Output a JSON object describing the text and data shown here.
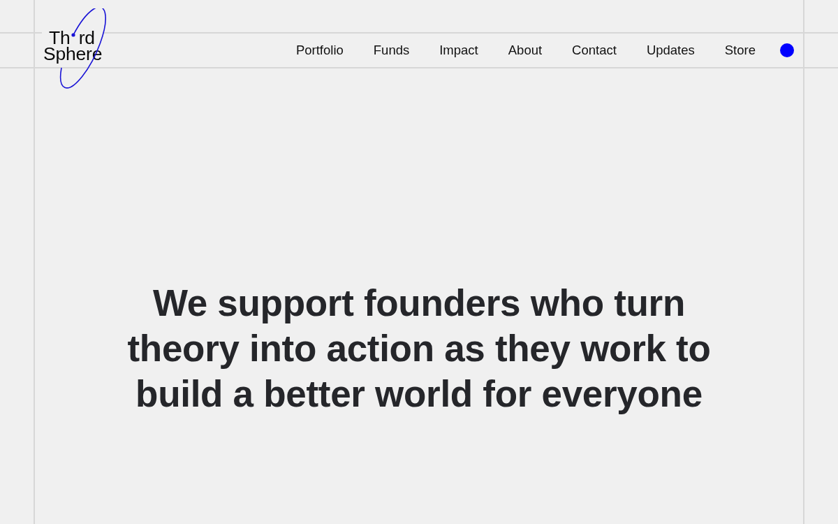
{
  "logo": {
    "lines": [
      "Th rd",
      "Sphere"
    ]
  },
  "nav": {
    "items": [
      "Portfolio",
      "Funds",
      "Impact",
      "About",
      "Contact",
      "Updates",
      "Store"
    ]
  },
  "hero": {
    "headline_lines": [
      "We support founders who turn",
      "theory into action as they work to",
      "build a better world for everyone"
    ]
  }
}
